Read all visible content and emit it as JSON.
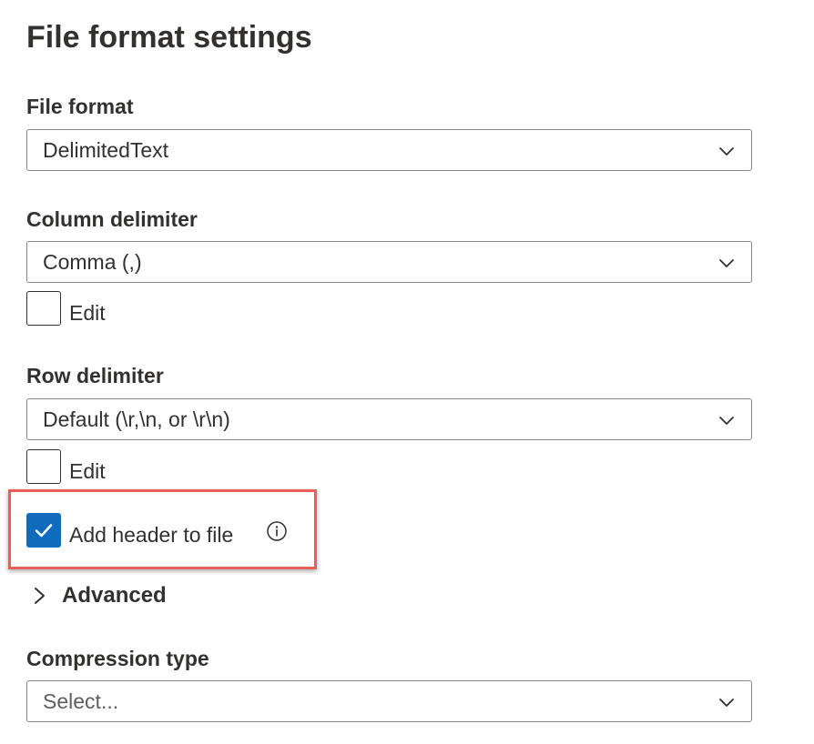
{
  "page": {
    "title": "File format settings"
  },
  "file_format": {
    "label": "File format",
    "value": "DelimitedText"
  },
  "column_delimiter": {
    "label": "Column delimiter",
    "value": "Comma (,)",
    "edit_label": "Edit",
    "edit_checked": false
  },
  "row_delimiter": {
    "label": "Row delimiter",
    "value": "Default (\\r,\\n, or \\r\\n)",
    "edit_label": "Edit",
    "edit_checked": false
  },
  "add_header": {
    "label": "Add header to file",
    "checked": true
  },
  "advanced": {
    "label": "Advanced",
    "expanded": false
  },
  "compression_type": {
    "label": "Compression type",
    "placeholder": "Select..."
  },
  "colors": {
    "accent": "#0f6cbd",
    "highlight": "#e8605a",
    "text": "#323130",
    "border": "#8a8886"
  },
  "icons": {
    "dropdown": "chevron-down-icon",
    "checkmark": "checkmark-icon",
    "info": "info-icon",
    "expand": "chevron-right-icon"
  }
}
